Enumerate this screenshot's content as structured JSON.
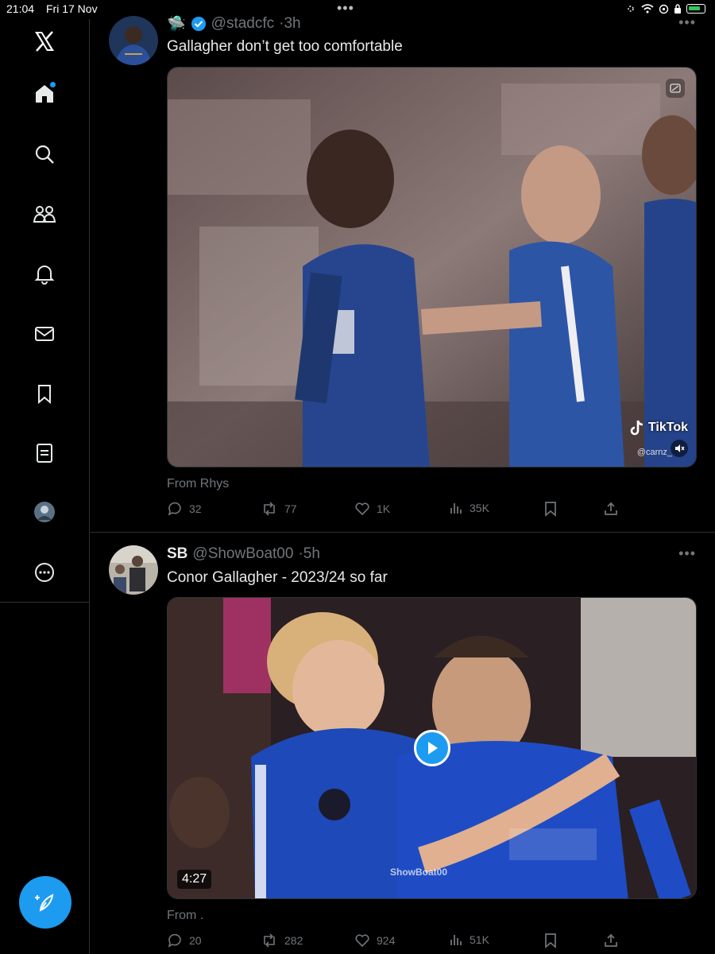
{
  "status_bar": {
    "time": "21:04",
    "date": "Fri 17 Nov",
    "dots": "•••"
  },
  "sidebar": {
    "items": [
      {
        "icon": "x-logo-icon"
      },
      {
        "icon": "home-icon"
      },
      {
        "icon": "search-icon"
      },
      {
        "icon": "communities-icon"
      },
      {
        "icon": "bell-icon"
      },
      {
        "icon": "mail-icon"
      },
      {
        "icon": "bookmark-icon"
      },
      {
        "icon": "lists-icon"
      },
      {
        "icon": "profile-avatar"
      },
      {
        "icon": "more-circle-icon"
      }
    ],
    "compose_icon": "compose-feather-icon",
    "accent": "#1d9bf0"
  },
  "tweets": [
    {
      "badge": "🛸",
      "verified": true,
      "handle": "@stadcfc",
      "time": "·3h",
      "text": "Gallagher don’t get too comfortable",
      "media": {
        "tiktok_label": "TikTok",
        "tiktok_user": "@carnz_"
      },
      "from": "From Rhys",
      "actions": {
        "replies": "32",
        "reposts": "77",
        "likes": "1K",
        "views": "35K"
      }
    },
    {
      "name": "SB",
      "handle": "@ShowBoat00",
      "time": "·5h",
      "text": "Conor Gallagher - 2023/24 so far",
      "media": {
        "duration": "4:27",
        "watermark": "ShowBoat00"
      },
      "from": "From .",
      "actions": {
        "replies": "20",
        "reposts": "282",
        "likes": "924",
        "views": "51K"
      }
    }
  ]
}
